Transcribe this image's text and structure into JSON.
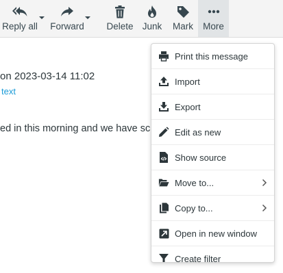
{
  "toolbar": {
    "reply_all": "Reply all",
    "forward": "Forward",
    "delete": "Delete",
    "junk": "Junk",
    "mark": "Mark",
    "more": "More"
  },
  "message": {
    "date_line": "on 2023-03-14 11:02",
    "link_text": "text",
    "body_line": "ed in this morning and we have sche"
  },
  "menu": {
    "print": "Print this message",
    "import": "Import",
    "export": "Export",
    "edit_as_new": "Edit as new",
    "show_source": "Show source",
    "move_to": "Move to...",
    "copy_to": "Copy to...",
    "open_new_window": "Open in new window",
    "create_filter": "Create filter"
  },
  "colors": {
    "toolbar_bg": "#f4f4f4",
    "active_bg": "#e1e4e6",
    "link": "#1b9bd7",
    "icon": "#37474f"
  }
}
